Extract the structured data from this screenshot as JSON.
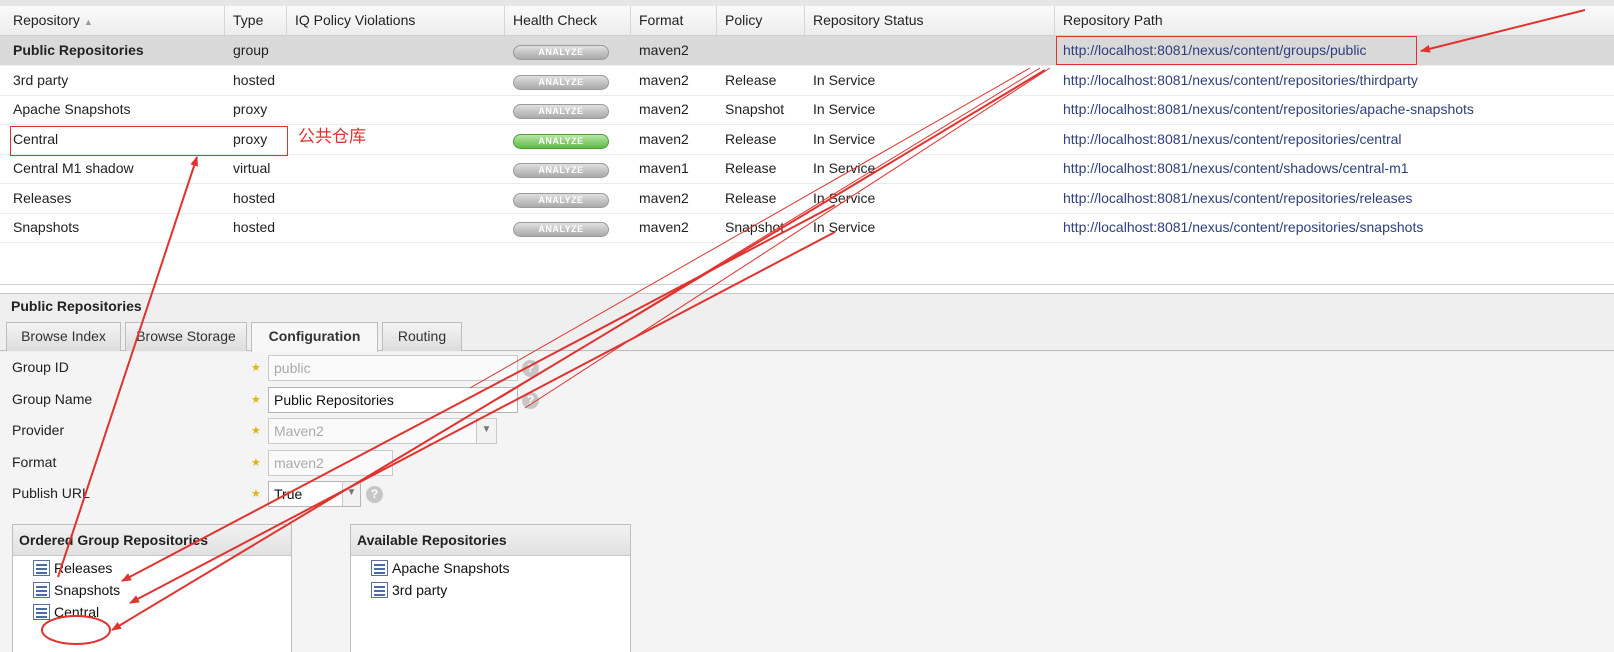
{
  "grid": {
    "headers": [
      "Repository",
      "Type",
      "IQ Policy Violations",
      "Health Check",
      "Format",
      "Policy",
      "Repository Status",
      "Repository Path"
    ],
    "sort_indicator": "▲",
    "analyze_label": "ANALYZE",
    "rows": [
      {
        "name": "Public Repositories",
        "type": "group",
        "format": "maven2",
        "policy": "",
        "status": "",
        "path": "http://localhost:8081/nexus/content/groups/public",
        "analyze": "gray",
        "selected": true
      },
      {
        "name": "3rd party",
        "type": "hosted",
        "format": "maven2",
        "policy": "Release",
        "status": "In Service",
        "path": "http://localhost:8081/nexus/content/repositories/thirdparty",
        "analyze": "gray"
      },
      {
        "name": "Apache Snapshots",
        "type": "proxy",
        "format": "maven2",
        "policy": "Snapshot",
        "status": "In Service",
        "path": "http://localhost:8081/nexus/content/repositories/apache-snapshots",
        "analyze": "gray"
      },
      {
        "name": "Central",
        "type": "proxy",
        "format": "maven2",
        "policy": "Release",
        "status": "In Service",
        "path": "http://localhost:8081/nexus/content/repositories/central",
        "analyze": "green"
      },
      {
        "name": "Central M1 shadow",
        "type": "virtual",
        "format": "maven1",
        "policy": "Release",
        "status": "In Service",
        "path": "http://localhost:8081/nexus/content/shadows/central-m1",
        "analyze": "gray"
      },
      {
        "name": "Releases",
        "type": "hosted",
        "format": "maven2",
        "policy": "Release",
        "status": "In Service",
        "path": "http://localhost:8081/nexus/content/repositories/releases",
        "analyze": "gray"
      },
      {
        "name": "Snapshots",
        "type": "hosted",
        "format": "maven2",
        "policy": "Snapshot",
        "status": "In Service",
        "path": "http://localhost:8081/nexus/content/repositories/snapshots",
        "analyze": "gray"
      }
    ]
  },
  "panel": {
    "title": "Public Repositories",
    "tabs": [
      "Browse Index",
      "Browse Storage",
      "Configuration",
      "Routing"
    ],
    "active_tab": "Configuration",
    "form": {
      "group_id_label": "Group ID",
      "group_id_value": "public",
      "group_name_label": "Group Name",
      "group_name_value": "Public Repositories",
      "provider_label": "Provider",
      "provider_value": "Maven2",
      "format_label": "Format",
      "format_value": "maven2",
      "publish_url_label": "Publish URL",
      "publish_url_value": "True",
      "help_glyph": "?",
      "required_glyph": "★",
      "dropdown_glyph": "▼"
    },
    "ordered": {
      "title": "Ordered Group Repositories",
      "items": [
        "Releases",
        "Snapshots",
        "Central"
      ]
    },
    "available": {
      "title": "Available Repositories",
      "items": [
        "Apache Snapshots",
        "3rd party"
      ]
    }
  },
  "annotation": {
    "label": "公共仓库",
    "color": "#e0332f"
  }
}
